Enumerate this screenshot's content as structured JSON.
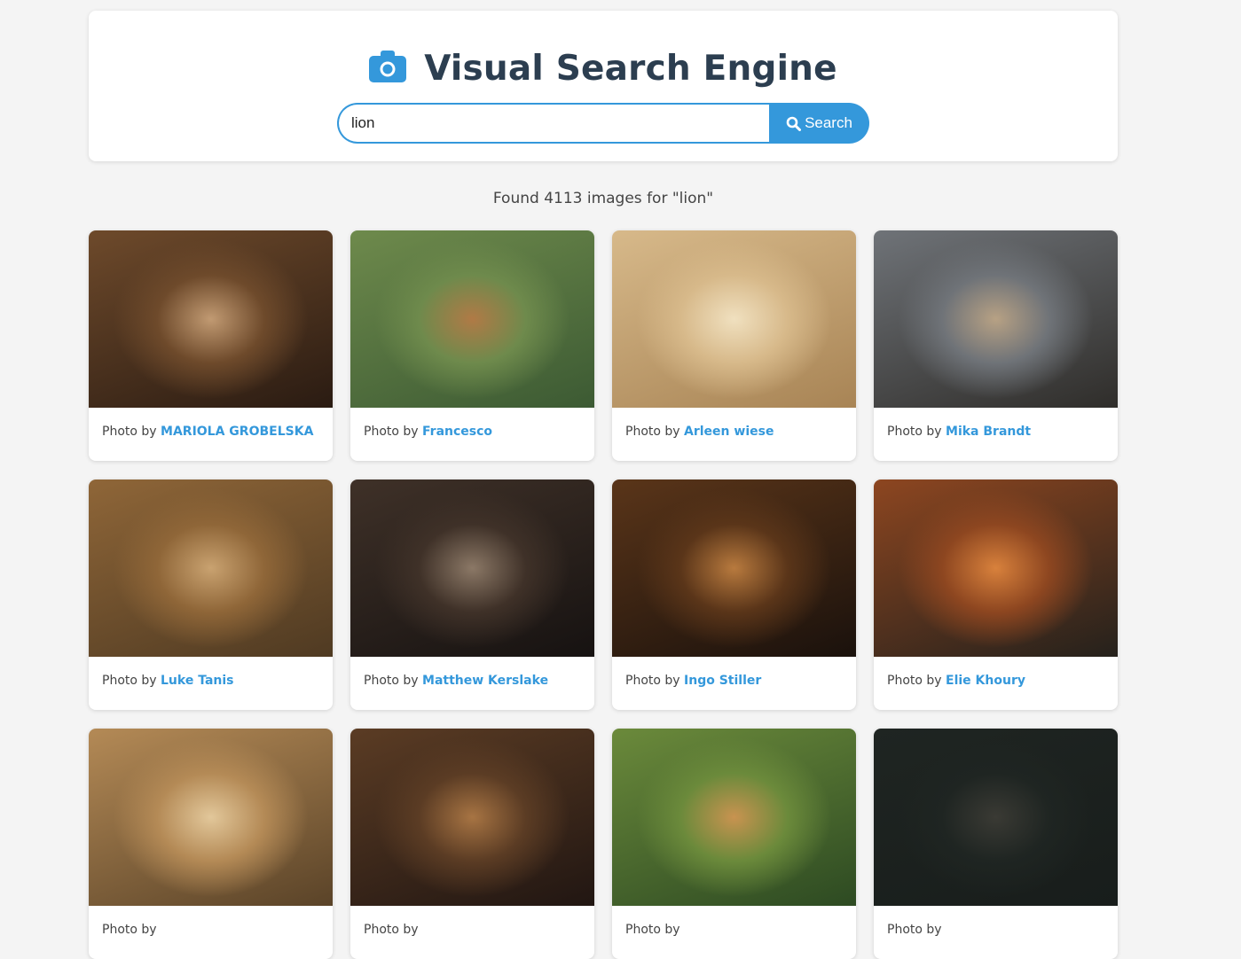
{
  "header": {
    "icon": "camera-icon",
    "title": "Visual Search Engine"
  },
  "search": {
    "value": "lion",
    "button_label": "Search",
    "button_icon": "search-icon"
  },
  "results": {
    "summary": "Found 4113 images for \"lion\""
  },
  "colors": {
    "accent": "#3498db",
    "title": "#2c3e50",
    "background": "#f4f4f4"
  },
  "caption_prefix": "Photo by",
  "cards": [
    {
      "photographer": "MARIOLA GROBELSKA",
      "palette": [
        "#c19a72",
        "#6e4a2b",
        "#2a1b12"
      ]
    },
    {
      "photographer": "Francesco",
      "palette": [
        "#b07a46",
        "#6e8a4c",
        "#3c5a33"
      ]
    },
    {
      "photographer": "Arleen wiese",
      "palette": [
        "#f0e0bf",
        "#d7b98a",
        "#a88455"
      ]
    },
    {
      "photographer": "Mika Brandt",
      "palette": [
        "#b7a184",
        "#6f7378",
        "#2f2d2a"
      ]
    },
    {
      "photographer": "Luke Tanis",
      "palette": [
        "#c9a270",
        "#8f6638",
        "#4f3a22"
      ]
    },
    {
      "photographer": "Matthew Kerslake",
      "palette": [
        "#8b7866",
        "#3f3128",
        "#161211"
      ]
    },
    {
      "photographer": "Ingo Stiller",
      "palette": [
        "#b87a3e",
        "#5a3519",
        "#1a110c"
      ]
    },
    {
      "photographer": "Elie Khoury",
      "palette": [
        "#d8813c",
        "#8d4620",
        "#25211c"
      ]
    },
    {
      "photographer": "",
      "palette": [
        "#e2c79a",
        "#b48a56",
        "#5a4328"
      ]
    },
    {
      "photographer": "",
      "palette": [
        "#a77443",
        "#5b3c24",
        "#211612"
      ]
    },
    {
      "photographer": "",
      "palette": [
        "#c89350",
        "#6b8a3b",
        "#2d4a22"
      ]
    },
    {
      "photographer": "",
      "palette": [
        "#3a3a34",
        "#1f2522",
        "#181d1b"
      ]
    }
  ]
}
